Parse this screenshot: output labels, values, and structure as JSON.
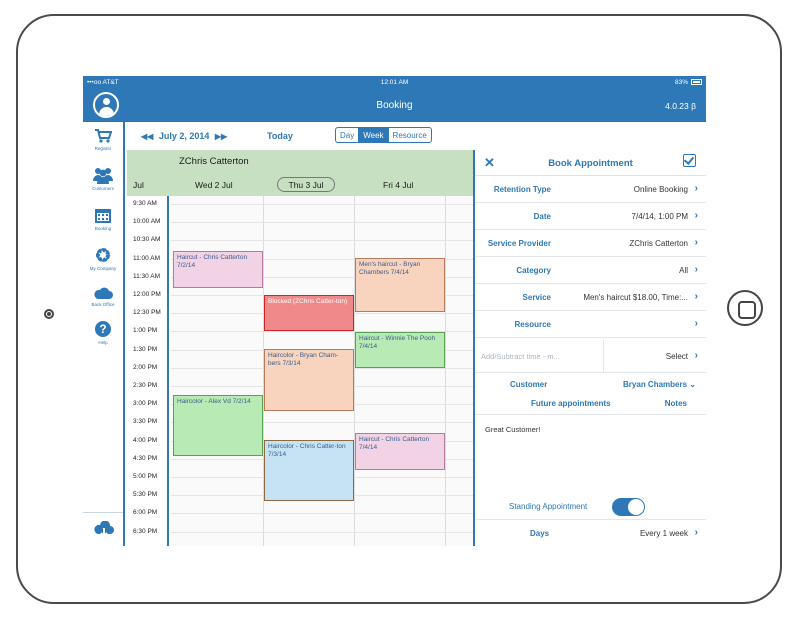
{
  "status": {
    "carrier": "•••oo AT&T",
    "time": "12:01 AM",
    "battery": "83%"
  },
  "nav": {
    "title": "Booking",
    "version": "4.0.23 β"
  },
  "sidebar": {
    "items": [
      {
        "label": "Register",
        "icon": "cart-icon"
      },
      {
        "label": "Customers",
        "icon": "people-icon"
      },
      {
        "label": "Booking",
        "icon": "calendar-icon"
      },
      {
        "label": "My Company",
        "icon": "gear-icon"
      },
      {
        "label": "Back Office",
        "icon": "cloud-icon"
      },
      {
        "label": "Help",
        "icon": "help-icon"
      }
    ]
  },
  "toolbar": {
    "prev": "◀◀",
    "date": "July 2, 2014",
    "next": "▶▶",
    "today": "Today",
    "views": [
      "Day",
      "Week",
      "Resource"
    ],
    "active_view": "Week"
  },
  "calendar": {
    "provider": "ZChris Catterton",
    "month": "Jul",
    "days": [
      "Wed 2 Jul",
      "Thu 3 Jul",
      "Fri 4 Jul"
    ],
    "times": [
      "9:30 AM",
      "10:00 AM",
      "10:30 AM",
      "11:00 AM",
      "11:30 AM",
      "12:00 PM",
      "12:30 PM",
      "1:00 PM",
      "1:30 PM",
      "2:00 PM",
      "2:30 PM",
      "3:00 PM",
      "3:30 PM",
      "4:00 PM",
      "4:30 PM",
      "5:00 PM",
      "5:30 PM",
      "6:00 PM",
      "6:30 PM"
    ],
    "appointments": [
      {
        "text": "Haircut - Chris Catterton 7/2/14",
        "color": "pink"
      },
      {
        "text": "Blocked (ZChris Catter-ton)",
        "color": "red"
      },
      {
        "text": "Men's haircut - Bryan Chambers 7/4/14",
        "color": "peach"
      },
      {
        "text": "Haircut - Winnie The Pooh 7/4/14",
        "color": "green"
      },
      {
        "text": "Haircolor - Bryan Cham-bers 7/3/14",
        "color": "peach"
      },
      {
        "text": "Haircolor - Alex Vd 7/2/14",
        "color": "green"
      },
      {
        "text": "Haircolor - Chris Catter-ton 7/3/14",
        "color": "blue"
      },
      {
        "text": "Haircut - Chris Catterton 7/4/14",
        "color": "pink"
      }
    ]
  },
  "panel": {
    "title": "Book Appointment",
    "rows": [
      {
        "label": "Retention Type",
        "value": "Online Booking"
      },
      {
        "label": "Date",
        "value": "7/4/14, 1:00 PM"
      },
      {
        "label": "Service Provider",
        "value": "ZChris Catterton"
      },
      {
        "label": "Category",
        "value": "All"
      },
      {
        "label": "Service",
        "value": "Men's haircut  $18.00, Time:..."
      },
      {
        "label": "Resource",
        "value": ""
      }
    ],
    "add_subtract_placeholder": "Add/Subtract time - m...",
    "select_label": "Select",
    "customer_label": "Customer",
    "customer_value": "Bryan Chambers",
    "future_link": "Future appointments",
    "notes_link": "Notes",
    "note_text": "Great Customer!",
    "standing_label": "Standing Appointment",
    "standing_on": true,
    "days_label": "Days",
    "days_value": "Every 1 week"
  }
}
